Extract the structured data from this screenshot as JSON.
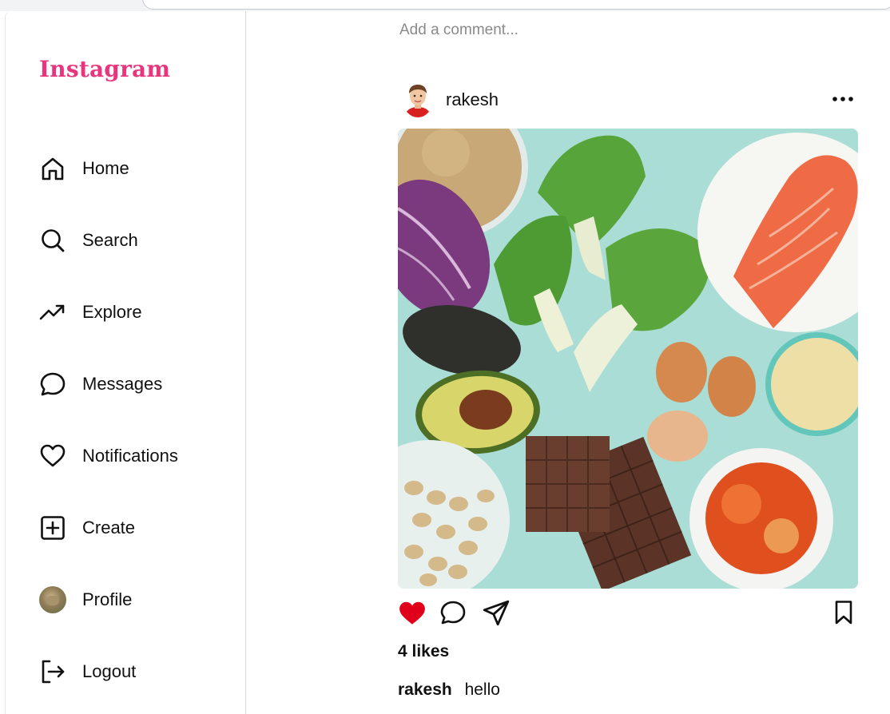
{
  "app": {
    "logo_text": "Instagram",
    "brand_color": "#e8357d"
  },
  "sidebar": {
    "items": [
      {
        "label": "Home",
        "icon": "home-icon"
      },
      {
        "label": "Search",
        "icon": "search-icon"
      },
      {
        "label": "Explore",
        "icon": "trending-icon"
      },
      {
        "label": "Messages",
        "icon": "message-icon"
      },
      {
        "label": "Notifications",
        "icon": "heart-icon"
      },
      {
        "label": "Create",
        "icon": "plus-square-icon"
      },
      {
        "label": "Profile",
        "icon": "avatar"
      },
      {
        "label": "Logout",
        "icon": "logout-icon"
      }
    ]
  },
  "feed": {
    "comment_placeholder": "Add a comment...",
    "post": {
      "username": "rakesh",
      "likes_text": "4 likes",
      "caption_user": "rakesh",
      "caption_text": "hello",
      "liked": true,
      "like_color": "#e0001b"
    }
  }
}
